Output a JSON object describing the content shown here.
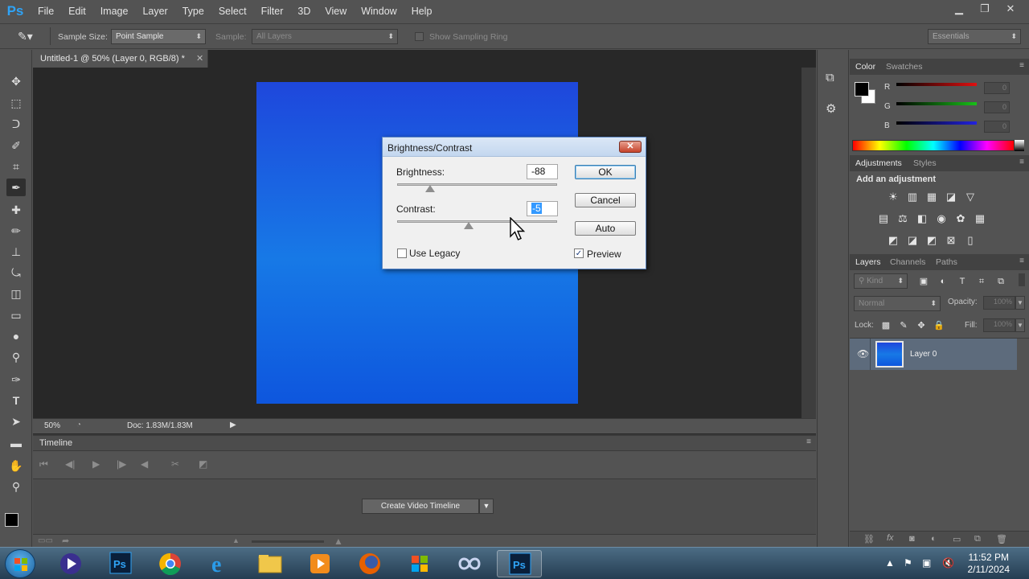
{
  "app": {
    "logo": "Ps",
    "menu": [
      "File",
      "Edit",
      "Image",
      "Layer",
      "Type",
      "Select",
      "Filter",
      "3D",
      "View",
      "Window",
      "Help"
    ],
    "window_controls": [
      "minimize-icon",
      "restore-icon",
      "close-icon"
    ]
  },
  "options_bar": {
    "sample_size_label": "Sample Size:",
    "sample_size_value": "Point Sample",
    "sample_label": "Sample:",
    "sample_value": "All Layers",
    "sampling_ring_label": "Show Sampling Ring",
    "workspace": "Essentials"
  },
  "document": {
    "tab_title": "Untitled-1 @ 50% (Layer 0, RGB/8) *",
    "zoom": "50%",
    "doc_info": "Doc: 1.83M/1.83M",
    "gradient_colors": [
      "#1e47dc",
      "#1779e6",
      "#0e56de"
    ]
  },
  "timeline": {
    "title": "Timeline",
    "create_button": "Create Video Timeline"
  },
  "color_panel": {
    "tabs": [
      "Color",
      "Swatches"
    ],
    "channels": [
      {
        "label": "R",
        "value": "0",
        "color": "#d11"
      },
      {
        "label": "G",
        "value": "0",
        "color": "#1b1"
      },
      {
        "label": "B",
        "value": "0",
        "color": "#22c"
      }
    ]
  },
  "adjustments_panel": {
    "tabs": [
      "Adjustments",
      "Styles"
    ],
    "heading": "Add an adjustment"
  },
  "layers_panel": {
    "tabs": [
      "Layers",
      "Channels",
      "Paths"
    ],
    "kind_label": "Kind",
    "blend_mode": "Normal",
    "opacity_label": "Opacity:",
    "opacity_value": "100%",
    "lock_label": "Lock:",
    "fill_label": "Fill:",
    "fill_value": "100%",
    "layers": [
      {
        "name": "Layer 0",
        "visible": true,
        "selected": true
      }
    ]
  },
  "dialog": {
    "title": "Brightness/Contrast",
    "brightness_label": "Brightness:",
    "brightness_value": "-88",
    "contrast_label": "Contrast:",
    "contrast_value": "-5",
    "use_legacy_label": "Use Legacy",
    "use_legacy_checked": false,
    "preview_label": "Preview",
    "preview_checked": true,
    "ok_label": "OK",
    "cancel_label": "Cancel",
    "auto_label": "Auto"
  },
  "taskbar": {
    "apps": [
      {
        "name": "media-player-icon",
        "active": false
      },
      {
        "name": "photoshop-icon",
        "active": false
      },
      {
        "name": "chrome-icon",
        "active": false
      },
      {
        "name": "internet-explorer-icon",
        "active": false
      },
      {
        "name": "file-explorer-icon",
        "active": false
      },
      {
        "name": "media-app-icon",
        "active": false
      },
      {
        "name": "firefox-icon",
        "active": false
      },
      {
        "name": "windows-app-icon",
        "active": false
      },
      {
        "name": "infinity-app-icon",
        "active": false
      },
      {
        "name": "photoshop-icon",
        "active": true
      }
    ],
    "time": "11:52 PM",
    "date": "2/11/2024"
  }
}
